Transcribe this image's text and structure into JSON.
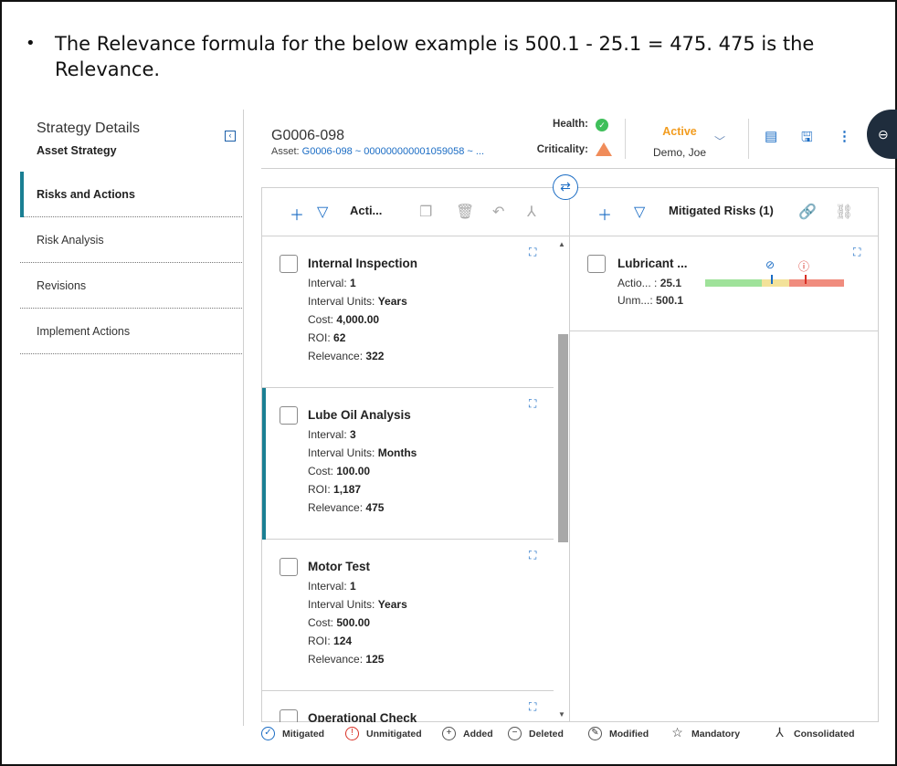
{
  "note": {
    "bullet": "•",
    "text": "The Relevance formula for the below example is 500.1 - 25.1 = 475. 475 is the Relevance."
  },
  "nav": {
    "title": "Strategy Details",
    "subtitle": "Asset Strategy",
    "collapse_icon": "‹",
    "items": [
      {
        "label": "Risks and Actions",
        "active": true
      },
      {
        "label": "Risk Analysis"
      },
      {
        "label": "Revisions"
      },
      {
        "label": "Implement Actions"
      }
    ]
  },
  "header": {
    "asset_id": "G0006-098",
    "asset_label": "Asset:",
    "asset_link": "G0006-098 ~ 000000000001059058 ~ ...",
    "health_label": "Health:",
    "criticality_label": "Criticality:",
    "status": "Active",
    "owner": "Demo, Joe",
    "health_icon": "check-circle",
    "criticality_icon": "triangle",
    "colors": {
      "status": "#f29c1f",
      "health": "#3fbf5a",
      "criticality": "#f08c5a",
      "accent": "#1a7f93",
      "link": "#1a6cc4"
    }
  },
  "actions_panel": {
    "title": "Acti...",
    "cards": [
      {
        "title": "Internal Inspection",
        "interval": "1",
        "interval_units": "Years",
        "cost": "4,000.00",
        "roi": "62",
        "relevance": "322"
      },
      {
        "title": "Lube Oil Analysis",
        "interval": "3",
        "interval_units": "Months",
        "cost": "100.00",
        "roi": "1,187",
        "relevance": "475",
        "active": true
      },
      {
        "title": "Motor Test",
        "interval": "1",
        "interval_units": "Years",
        "cost": "500.00",
        "roi": "124",
        "relevance": "125"
      },
      {
        "title": "Operational Check"
      }
    ],
    "labels": {
      "interval": "Interval:",
      "interval_units": "Interval Units:",
      "cost": "Cost:",
      "roi": "ROI:",
      "relevance": "Relevance:"
    }
  },
  "risks_panel": {
    "title": "Mitigated Risks (1)",
    "risk": {
      "title": "Lubricant ...",
      "actio_label": "Actio... :",
      "actio_value": "25.1",
      "unm_label": "Unm...:",
      "unm_value": "500.1"
    }
  },
  "legend": [
    {
      "label": "Mitigated",
      "icon": "check-circle-icon"
    },
    {
      "label": "Unmitigated",
      "icon": "exclamation-circle-icon"
    },
    {
      "label": "Added",
      "icon": "plus-circle-icon"
    },
    {
      "label": "Deleted",
      "icon": "minus-circle-icon"
    },
    {
      "label": "Modified",
      "icon": "pencil-circle-icon"
    },
    {
      "label": "Mandatory",
      "icon": "star-icon"
    },
    {
      "label": "Consolidated",
      "icon": "consolidate-icon"
    }
  ]
}
